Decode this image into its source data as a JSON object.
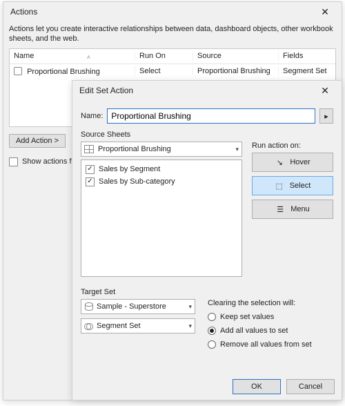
{
  "actions_window": {
    "title": "Actions",
    "description": "Actions let you create interactive relationships between data, dashboard objects, other workbook sheets, and the web.",
    "columns": {
      "name": "Name",
      "run_on": "Run On",
      "source": "Source",
      "fields": "Fields"
    },
    "row": {
      "name": "Proportional Brushing",
      "run_on": "Select",
      "source": "Proportional Brushing",
      "fields": "Segment Set"
    },
    "add_button": "Add Action >",
    "show_actions_label": "Show actions for"
  },
  "modal": {
    "title": "Edit Set Action",
    "name_label": "Name:",
    "name_value": "Proportional Brushing",
    "source_sheets_label": "Source Sheets",
    "source_combo": "Proportional Brushing",
    "sheets": [
      "Sales by Segment",
      "Sales by Sub-category"
    ],
    "run_action_label": "Run action on:",
    "run_buttons": {
      "hover": "Hover",
      "select": "Select",
      "menu": "Menu"
    },
    "target_set_label": "Target Set",
    "datasource": "Sample - Superstore",
    "set": "Segment Set",
    "clearing_label": "Clearing the selection will:",
    "radios": {
      "keep": "Keep set values",
      "add": "Add all values to set",
      "remove": "Remove all values from set"
    },
    "ok": "OK",
    "cancel": "Cancel"
  }
}
